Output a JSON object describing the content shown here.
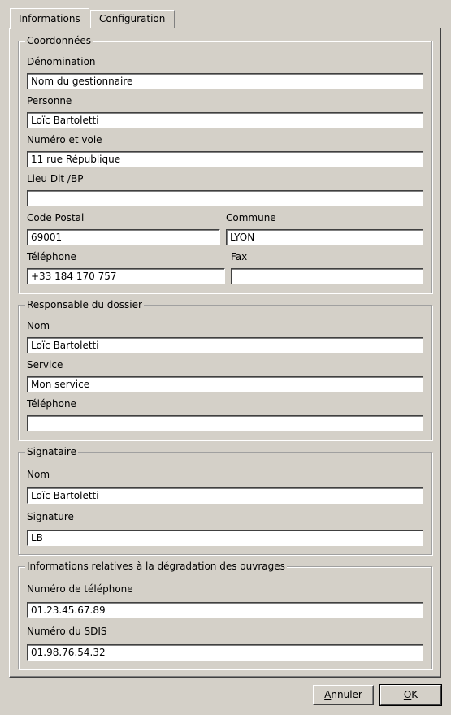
{
  "tabs": {
    "informations": "Informations",
    "configuration": "Configuration"
  },
  "coordonnees": {
    "legend": "Coordonnées",
    "denomination_label": "Dénomination",
    "denomination_value": "Nom du gestionnaire",
    "personne_label": "Personne",
    "personne_value": "Loïc Bartoletti",
    "numero_voie_label": "Numéro et voie",
    "numero_voie_value": "11 rue République",
    "lieu_dit_label": "Lieu Dit /BP",
    "lieu_dit_value": "",
    "code_postal_label": "Code Postal",
    "code_postal_value": "69001",
    "commune_label": "Commune",
    "commune_value": "LYON",
    "telephone_label": "Téléphone",
    "telephone_value": "+33 184 170 757",
    "fax_label": "Fax",
    "fax_value": ""
  },
  "responsable": {
    "legend": "Responsable du dossier",
    "nom_label": "Nom",
    "nom_value": "Loïc Bartoletti",
    "service_label": "Service",
    "service_value": "Mon service",
    "telephone_label": "Téléphone",
    "telephone_value": ""
  },
  "signataire": {
    "legend": "Signataire",
    "nom_label": "Nom",
    "nom_value": "Loïc Bartoletti",
    "signature_label": "Signature",
    "signature_value": "LB"
  },
  "degradation": {
    "legend": "Informations relatives à la dégradation des ouvrages",
    "numero_telephone_label": "Numéro de téléphone",
    "numero_telephone_value": "01.23.45.67.89",
    "numero_sdis_label": "Numéro du SDIS",
    "numero_sdis_value": "01.98.76.54.32"
  },
  "buttons": {
    "annuler_mnemonic": "A",
    "annuler_rest": "nnuler",
    "ok_mnemonic": "O",
    "ok_rest": "K"
  }
}
